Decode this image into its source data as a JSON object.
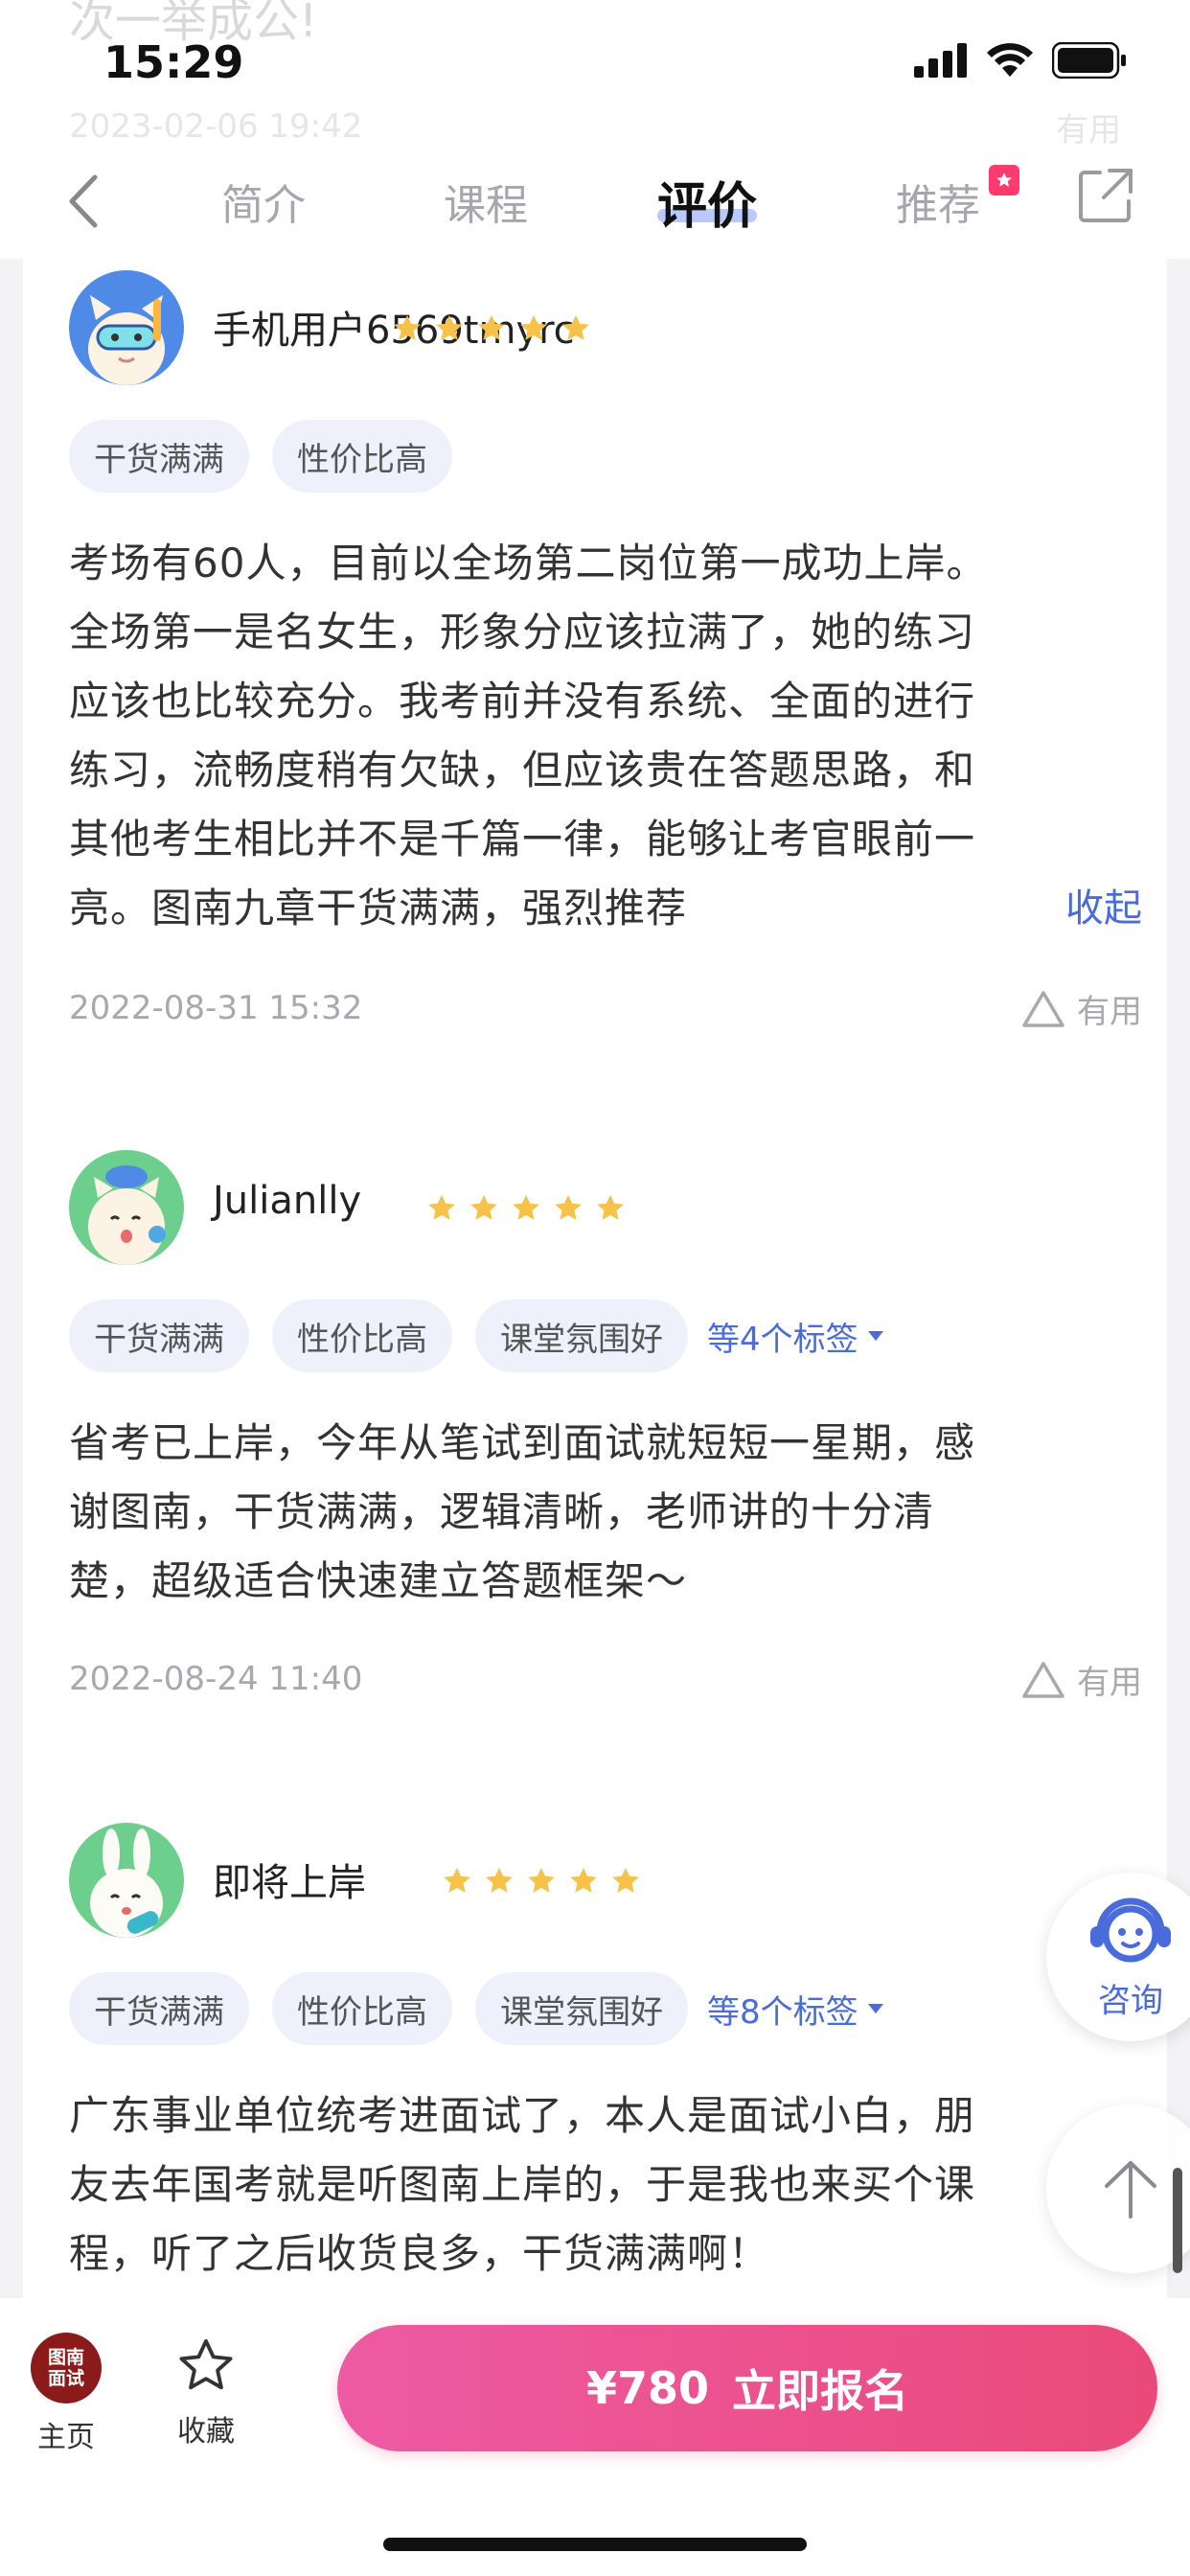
{
  "status_bar": {
    "time": "15:29"
  },
  "behind_header": {
    "text": "次一举成公!",
    "date": "2023-02-06 19:42",
    "useful": "有用"
  },
  "nav": {
    "tabs": [
      {
        "label": "简介"
      },
      {
        "label": "课程"
      },
      {
        "label": "评价"
      },
      {
        "label": "推荐"
      }
    ],
    "active_tab": "评价"
  },
  "reviews": [
    {
      "user": "手机用户6569tmyrc",
      "stars": 5,
      "tags": [
        "干货满满",
        "性价比高"
      ],
      "more_tags": "",
      "lines": [
        "考场有60人，目前以全场第二岗位第一成功上岸。",
        "全场第一是名女生，形象分应该拉满了，她的练习",
        "应该也比较充分。我考前并没有系统、全面的进行",
        "练习，流畅度稍有欠缺，但应该贵在答题思路，和",
        "其他考生相比并不是千篇一律，能够让考官眼前一",
        "亮。图南九章干货满满，强烈推荐"
      ],
      "collapse": "收起",
      "date": "2022-08-31 15:32",
      "useful": "有用"
    },
    {
      "user": "Julianlly",
      "stars": 5,
      "tags": [
        "干货满满",
        "性价比高",
        "课堂氛围好"
      ],
      "more_tags": "等4个标签",
      "lines": [
        "省考已上岸，今年从笔试到面试就短短一星期，感",
        "谢图南，干货满满，逻辑清晰，老师讲的十分清",
        "楚，超级适合快速建立答题框架～"
      ],
      "date": "2022-08-24 11:40",
      "useful": "有用"
    },
    {
      "user": "即将上岸",
      "stars": 5,
      "tags": [
        "干货满满",
        "性价比高",
        "课堂氛围好"
      ],
      "more_tags": "等8个标签",
      "lines": [
        "广东事业单位统考进面试了，本人是面试小白，朋",
        "友去年国考就是听图南上岸的，于是我也来买个课",
        "程，听了之后收货良多，干货满满啊！"
      ]
    }
  ],
  "float": {
    "consult_label": "咨询"
  },
  "bottom_bar": {
    "home_logo": [
      "图南",
      "面试"
    ],
    "home_label": "主页",
    "fav_label": "收藏",
    "price": "¥780",
    "cta": "立即报名"
  },
  "colors": {
    "accent": "#4a6bdb",
    "cta_start": "#ee5aa3",
    "cta_end": "#ea4a7a",
    "star": "#f7c24a"
  }
}
